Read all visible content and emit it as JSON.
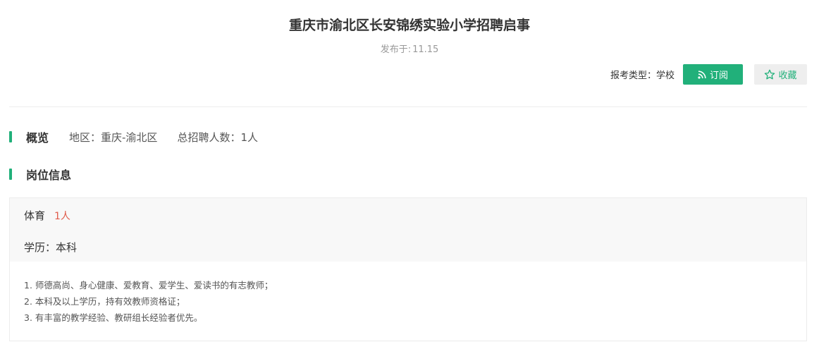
{
  "header": {
    "title": "重庆市渝北区长安锦绣实验小学招聘启事",
    "publish_label": "发布于:",
    "publish_date": "11.15",
    "exam_type": "报考类型：学校",
    "subscribe_label": "订阅",
    "subscribe_icon": "rss-icon",
    "favorite_label": "收藏",
    "favorite_icon": "star-icon"
  },
  "overview": {
    "title": "概览",
    "region": "地区：重庆-渝北区",
    "total": "总招聘人数：1人"
  },
  "positions": {
    "title": "岗位信息",
    "items": [
      {
        "name": "体育",
        "count": "1人",
        "education": "学历：本科",
        "requirements": [
          "1. 师德高尚、身心健康、爱教育、爱学生、爱读书的有志教师；",
          "2. 本科及以上学历，持有效教师资格证；",
          "3. 有丰富的教学经验、教研组长经验者优先。"
        ]
      }
    ]
  },
  "colors": {
    "accent": "#21b07a",
    "count_red": "#e05b4b",
    "muted": "#999999"
  }
}
